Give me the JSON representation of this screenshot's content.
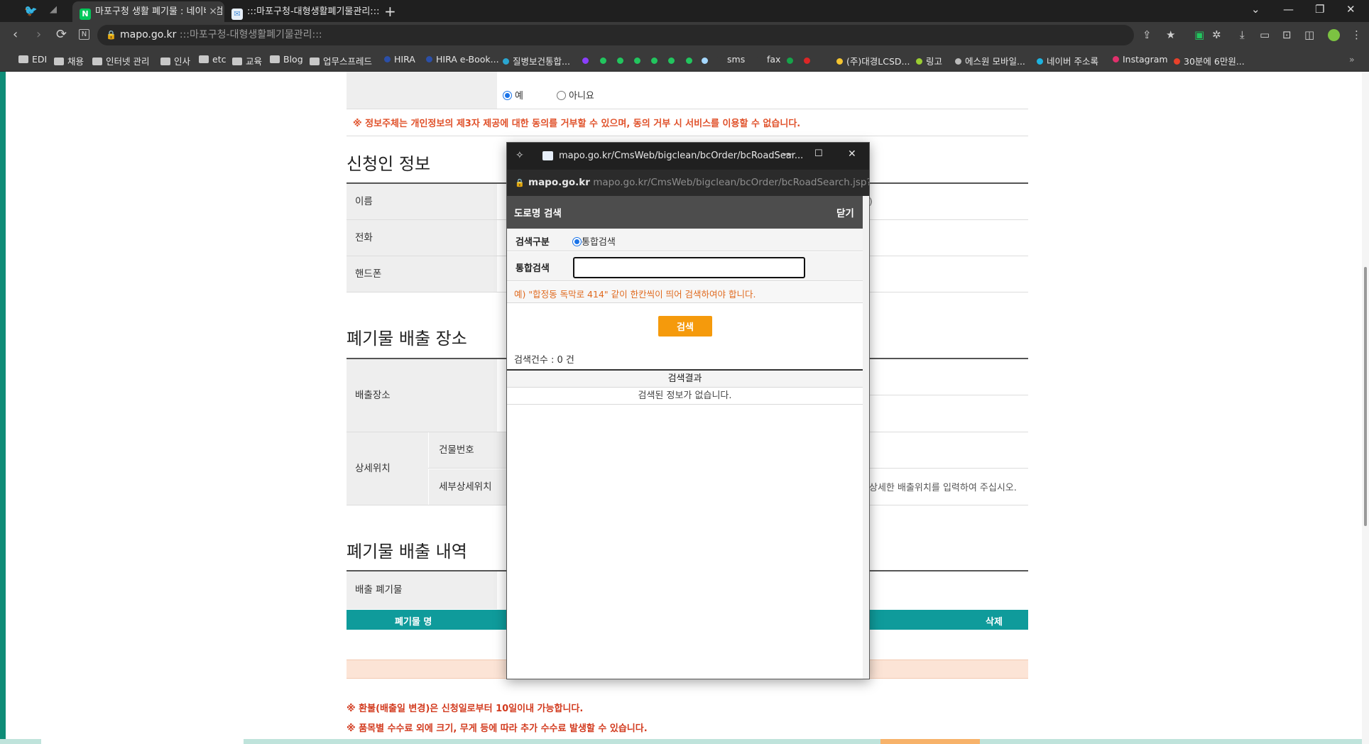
{
  "browser": {
    "tabs": [
      {
        "title": "마포구청 생활 폐기물 : 네이버 검",
        "favicon": "N",
        "favicon_color": "#03c75a",
        "active": true
      },
      {
        "title": ":::마포구청-대형생활폐기물관리:::",
        "favicon": "✉",
        "favicon_color": "#4a90d9",
        "active": false
      }
    ],
    "new_tab": "+",
    "address": {
      "domain": "mapo.go.kr",
      "path": ":::마포구청-대형생활폐기물관리:::"
    },
    "bookmarks": [
      {
        "label": "EDI",
        "kind": "folder"
      },
      {
        "label": "채용",
        "kind": "folder"
      },
      {
        "label": "인터넷 관리",
        "kind": "folder"
      },
      {
        "label": "인사",
        "kind": "folder"
      },
      {
        "label": "etc",
        "kind": "folder"
      },
      {
        "label": "교육",
        "kind": "folder"
      },
      {
        "label": "Blog",
        "kind": "folder"
      },
      {
        "label": "업무스프레드",
        "kind": "folder"
      },
      {
        "label": "HIRA",
        "kind": "site",
        "color": "#1e3a8a"
      },
      {
        "label": "HIRA e-Book...",
        "kind": "site",
        "color": "#1e3a8a"
      },
      {
        "label": "질병보건통합...",
        "kind": "site",
        "color": "#2aa6d1"
      },
      {
        "label": "sms",
        "kind": "site",
        "color": "#333333"
      },
      {
        "label": "fax",
        "kind": "site",
        "color": "#333333"
      },
      {
        "label": "(주)대경LCSD...",
        "kind": "site",
        "color": "#f4c430"
      },
      {
        "label": "링고",
        "kind": "site",
        "color": "#9acd32"
      },
      {
        "label": "에스원 모바일...",
        "kind": "site",
        "color": "#bbbbbb"
      },
      {
        "label": "네이버 주소록",
        "kind": "site",
        "color": "#1db3e0"
      },
      {
        "label": "Instagram",
        "kind": "site",
        "color": "#e1306c"
      },
      {
        "label": "30분에 6만원...",
        "kind": "site",
        "color": "#e8412a"
      }
    ],
    "dot_colors": [
      "#8a3ffc",
      "#22c55e",
      "#22c55e",
      "#22c55e",
      "#22c55e",
      "#22c55e",
      "#22c55e",
      "#a5d8ff",
      "#16a34a",
      "#dc2626"
    ]
  },
  "form": {
    "consent_yes": "예",
    "consent_no": "아니요",
    "consent_note": "※ 정보주체는 개인정보의 제3자 제공에 대한 동의를 거부할 수 있으며, 동의 거부 시 서비스를 이용할 수 없습니다.",
    "applicant_title": "신청인 정보",
    "name_label": "이름",
    "phone_label": "전화",
    "mobile_label": "핸드폰",
    "place_title": "폐기물 배출 장소",
    "place_label": "배출장소",
    "detail_label": "상세위치",
    "building_label": "건물번호",
    "subdetail_label": "세부상세위치",
    "subdetail_hint": "상세한 배출위치를 입력하여 주십시오.",
    "list_title": "폐기물 배출 내역",
    "waste_label": "배출 폐기물",
    "col_name": "폐기물 명",
    "col_delete": "삭제",
    "note_refund": "※ 환불(배출일 변경)은 신청일로부터 10일이내 가능합니다.",
    "note_fee": "※ 품목별 수수료 외에 크기, 무게 등에 따라 추가 수수료 발생할 수 있습니다."
  },
  "popup": {
    "title": "mapo.go.kr/CmsWeb/bigclean/bcOrder/bcRoadSear...",
    "url_domain": "mapo.go.kr",
    "url_path": "mapo.go.kr/CmsWeb/bigclean/bcOrder/bcRoadSearch.jsp?fr",
    "header": "도로명 검색",
    "close_label": "닫기",
    "search_type_label": "검색구분",
    "search_type_option": "통합검색",
    "search_field_label": "통합검색",
    "search_value": "",
    "example": "예) \"합정동 독막로 414\" 같이 한칸씩이 띄어 검색하여야 합니다.",
    "search_button": "검색",
    "count_text": "검색건수 : 0 건",
    "results_header": "검색결과",
    "no_results": "검색된 정보가 없습니다."
  }
}
